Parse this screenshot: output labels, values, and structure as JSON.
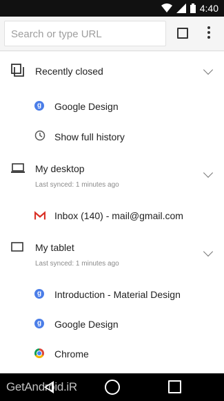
{
  "status_bar": {
    "time": "4:40",
    "icons": [
      "wifi-icon",
      "signal-icon",
      "battery-icon"
    ]
  },
  "toolbar": {
    "search_placeholder": "Search or type URL",
    "tabs_icon": "tab-switcher-icon",
    "menu_icon": "overflow-menu-icon"
  },
  "sections": {
    "recently_closed": {
      "title": "Recently closed",
      "items": [
        {
          "label": "Google Design",
          "icon": "google-favicon"
        },
        {
          "label": "Show full history",
          "icon": "clock-icon"
        }
      ]
    },
    "my_desktop": {
      "title": "My desktop",
      "subtitle": "Last synced: 1 minutes ago",
      "items": [
        {
          "label": "Inbox (140) - mail@gmail.com",
          "icon": "gmail-icon"
        }
      ]
    },
    "my_tablet": {
      "title": "My tablet",
      "subtitle": "Last synced: 1 minutes ago",
      "items": [
        {
          "label": "Introduction - Material Design",
          "icon": "google-favicon"
        },
        {
          "label": "Google Design",
          "icon": "google-favicon"
        },
        {
          "label": "Chrome",
          "icon": "chrome-icon"
        }
      ]
    }
  },
  "nav_bar": {
    "icons": [
      "back-icon",
      "home-icon",
      "recents-icon"
    ]
  },
  "watermark": "GetAndroid.iR",
  "colors": {
    "status_bar": "#111111",
    "toolbar": "#f5f5f5",
    "google_blue": "#4a7de8",
    "gmail_red": "#d93025"
  }
}
